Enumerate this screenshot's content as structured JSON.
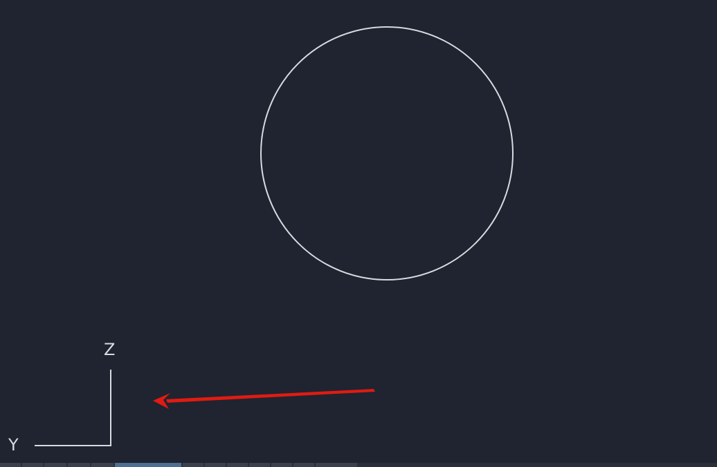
{
  "viewport": {
    "background": "#1f2430",
    "entity": "circle",
    "circle_color": "#d9dbe0"
  },
  "ucs": {
    "z_label": "Z",
    "y_label": "Y",
    "axis_color": "#d8dbe0"
  },
  "annotation": {
    "arrow_color": "#e01b12",
    "arrow_icon": "red-arrow-icon"
  },
  "statusbar": {
    "tabs": [
      "",
      "",
      "",
      "",
      "",
      "",
      "",
      "",
      "",
      "",
      "",
      "",
      ""
    ]
  }
}
